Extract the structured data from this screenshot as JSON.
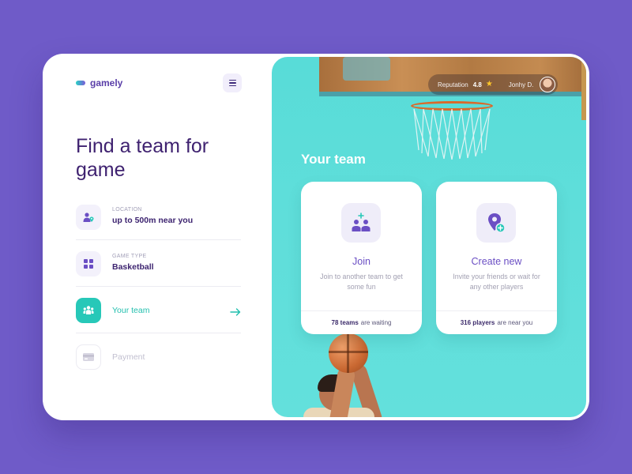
{
  "app": {
    "name": "gamely"
  },
  "left": {
    "headline": "Find a team for game",
    "steps": [
      {
        "caption": "LOCATION",
        "value": "up to 500m near you",
        "icon": "user-location-icon"
      },
      {
        "caption": "GAME TYPE",
        "value": "Basketball",
        "icon": "grid-icon"
      },
      {
        "caption": "",
        "value": "Your team",
        "icon": "team-icon",
        "state": "active"
      },
      {
        "caption": "",
        "value": "Payment",
        "icon": "card-icon",
        "state": "disabled"
      }
    ]
  },
  "profile": {
    "reputation_label": "Reputation",
    "reputation_score": "4.8",
    "user_name": "Jonhy D."
  },
  "team": {
    "title": "Your team",
    "options": [
      {
        "title": "Join",
        "description": "Join to another team to get some fun",
        "footer_count": "78 teams",
        "footer_text": "are waiting"
      },
      {
        "title": "Create new",
        "description": "Invite your friends or wait for any other players",
        "footer_count": "316 players",
        "footer_text": "are near you"
      }
    ]
  },
  "colors": {
    "background": "#6f5bc8",
    "accent_teal": "#27c8b8",
    "accent_purple": "#6b4fc4",
    "headline": "#3f2270"
  }
}
